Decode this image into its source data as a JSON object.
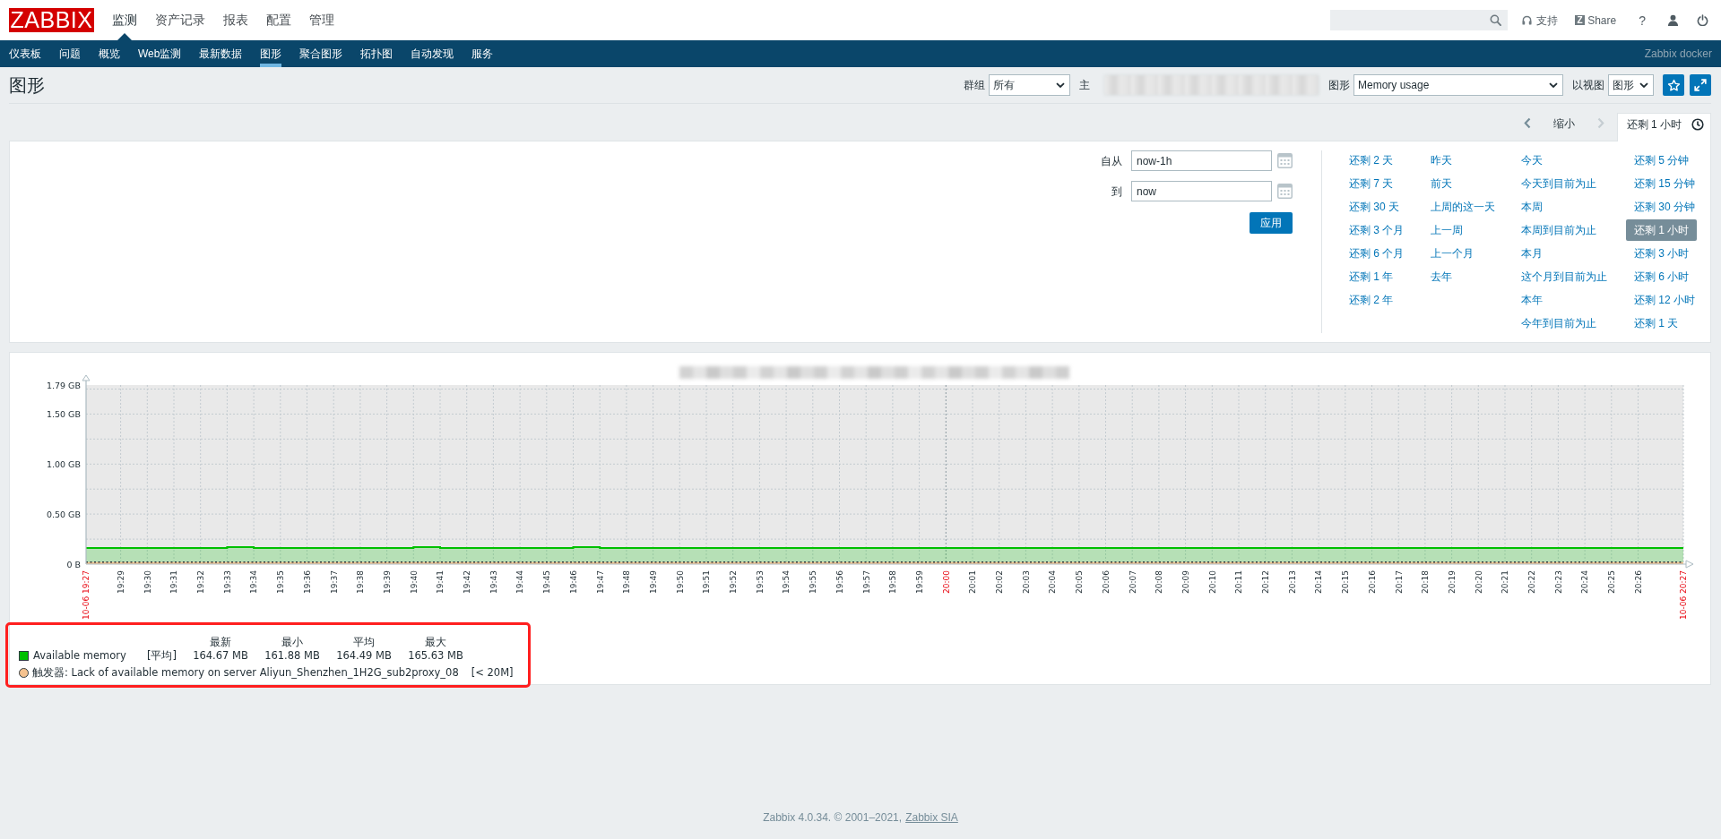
{
  "header": {
    "logo": "ZABBIX",
    "menu": [
      {
        "label": "监测",
        "selected": true
      },
      {
        "label": "资产记录",
        "selected": false
      },
      {
        "label": "报表",
        "selected": false
      },
      {
        "label": "配置",
        "selected": false
      },
      {
        "label": "管理",
        "selected": false
      }
    ],
    "support": "支持",
    "share": {
      "logo": "Z",
      "label": "Share"
    },
    "help": "?"
  },
  "subnav": {
    "items": [
      {
        "label": "仪表板",
        "selected": false
      },
      {
        "label": "问题",
        "selected": false
      },
      {
        "label": "概览",
        "selected": false
      },
      {
        "label": "Web监测",
        "selected": false
      },
      {
        "label": "最新数据",
        "selected": false
      },
      {
        "label": "图形",
        "selected": true
      },
      {
        "label": "聚合图形",
        "selected": false
      },
      {
        "label": "拓扑图",
        "selected": false
      },
      {
        "label": "自动发现",
        "selected": false
      },
      {
        "label": "服务",
        "selected": false
      }
    ],
    "server_name": "Zabbix docker"
  },
  "page": {
    "title": "图形",
    "filters": [
      {
        "kind": "select",
        "label": "群组",
        "value": "所有"
      },
      {
        "kind": "redacted",
        "label": "主"
      },
      {
        "kind": "select",
        "label": "图形",
        "value": "Memory usage"
      },
      {
        "kind": "select",
        "label": "以视图",
        "value": "图形"
      }
    ]
  },
  "timebar": {
    "previous": {
      "disabled": false
    },
    "zoom_out": "缩小",
    "next": {
      "disabled": true
    },
    "tab": "还剩 1 小时"
  },
  "time_filter": {
    "from": {
      "label": "自从",
      "value": "now-1h"
    },
    "to": {
      "label": "到",
      "value": "now"
    },
    "apply": "应用",
    "quick_ranges": [
      [
        {
          "label": "还剩 2 天",
          "selected": false
        },
        {
          "label": "还剩 7 天",
          "selected": false
        },
        {
          "label": "还剩 30 天",
          "selected": false
        },
        {
          "label": "还剩 3 个月",
          "selected": false
        },
        {
          "label": "还剩 6 个月",
          "selected": false
        },
        {
          "label": "还剩 1 年",
          "selected": false
        },
        {
          "label": "还剩 2 年",
          "selected": false
        }
      ],
      [
        {
          "label": "昨天",
          "selected": false
        },
        {
          "label": "前天",
          "selected": false
        },
        {
          "label": "上周的这一天",
          "selected": false
        },
        {
          "label": "上一周",
          "selected": false
        },
        {
          "label": "上一个月",
          "selected": false
        },
        {
          "label": "去年",
          "selected": false
        }
      ],
      [
        {
          "label": "今天",
          "selected": false
        },
        {
          "label": "今天到目前为止",
          "selected": false
        },
        {
          "label": "本周",
          "selected": false
        },
        {
          "label": "本周到目前为止",
          "selected": false
        },
        {
          "label": "本月",
          "selected": false
        },
        {
          "label": "这个月到目前为止",
          "selected": false
        },
        {
          "label": "本年",
          "selected": false
        },
        {
          "label": "今年到目前为止",
          "selected": false
        }
      ],
      [
        {
          "label": "还剩 5 分钟",
          "selected": false
        },
        {
          "label": "还剩 15 分钟",
          "selected": false
        },
        {
          "label": "还剩 30 分钟",
          "selected": false
        },
        {
          "label": "还剩 1 小时",
          "selected": true
        },
        {
          "label": "还剩 3 小时",
          "selected": false
        },
        {
          "label": "还剩 6 小时",
          "selected": false
        },
        {
          "label": "还剩 12 小时",
          "selected": false
        },
        {
          "label": "还剩 1 天",
          "selected": false
        }
      ]
    ]
  },
  "graph": {
    "chart_data": {
      "type": "area",
      "grid": true,
      "categories": [
        "10-06 19:27",
        null,
        "19:29",
        "19:30",
        "19:31",
        "19:32",
        "19:33",
        "19:34",
        "19:35",
        "19:36",
        "19:37",
        "19:38",
        "19:39",
        "19:40",
        "19:41",
        "19:42",
        "19:43",
        "19:44",
        "19:45",
        "19:46",
        "19:47",
        "19:48",
        "19:49",
        "19:50",
        "19:51",
        "19:52",
        "19:53",
        "19:54",
        "19:55",
        "19:56",
        "19:57",
        "19:58",
        "19:59",
        "20:00",
        "20:01",
        "20:02",
        "20:03",
        "20:04",
        "20:05",
        "20:06",
        "20:07",
        "20:08",
        "20:09",
        "20:10",
        "20:11",
        "20:12",
        "20:13",
        "20:14",
        "20:15",
        "20:16",
        "20:17",
        "20:18",
        "20:19",
        "20:20",
        "20:21",
        "20:22",
        "20:23",
        "20:24",
        "20:25",
        "20:26",
        "10-06 20:27"
      ],
      "ylim": [
        0,
        1.79
      ],
      "yticks": [
        {
          "value": 0,
          "label": "0 B"
        },
        {
          "value": 0.5,
          "label": "0.50 GB"
        },
        {
          "value": 1,
          "label": "1.00 GB"
        },
        {
          "value": 1.5,
          "label": "1.50 GB"
        },
        {
          "value": 1.79,
          "label": "1.79 GB"
        }
      ],
      "series": [
        {
          "name": "Available memory",
          "color": "#00c000",
          "values": [
            0.16,
            0.16,
            0.16,
            0.16,
            0.16,
            0.16,
            0.17,
            0.16,
            0.16,
            0.16,
            0.16,
            0.16,
            0.16,
            0.17,
            0.16,
            0.16,
            0.16,
            0.16,
            0.16,
            0.17,
            0.16,
            0.16,
            0.16,
            0.16,
            0.16,
            0.16,
            0.16,
            0.16,
            0.16,
            0.16,
            0.16,
            0.16,
            0.16,
            0.16,
            0.16,
            0.16,
            0.16,
            0.16,
            0.16,
            0.16,
            0.16,
            0.16,
            0.16,
            0.16,
            0.16,
            0.16,
            0.16,
            0.16,
            0.16,
            0.16,
            0.16,
            0.16,
            0.16,
            0.16,
            0.16,
            0.16,
            0.16,
            0.16,
            0.16,
            0.16,
            0.16
          ]
        }
      ],
      "ref_lines": [
        {
          "axis": "x",
          "value": "20:00"
        },
        {
          "axis": "y",
          "value": 0.02,
          "color": "#f5c28f"
        }
      ]
    },
    "legend": {
      "highlighted": true,
      "columns": [
        "最新",
        "最小",
        "平均",
        "最大"
      ],
      "items": [
        {
          "function": "[平均]",
          "values": [
            "164.67 MB",
            "161.88 MB",
            "164.49 MB",
            "165.63 MB"
          ]
        }
      ],
      "triggers": [
        {
          "text": "触发器: Lack of available memory on server Aliyun_Shenzhen_1H2G_sub2proxy_08",
          "condition": "[< 20M]"
        }
      ]
    }
  },
  "footer": {
    "text": "Zabbix 4.0.34. © 2001–2021,",
    "link": "Zabbix SIA"
  }
}
